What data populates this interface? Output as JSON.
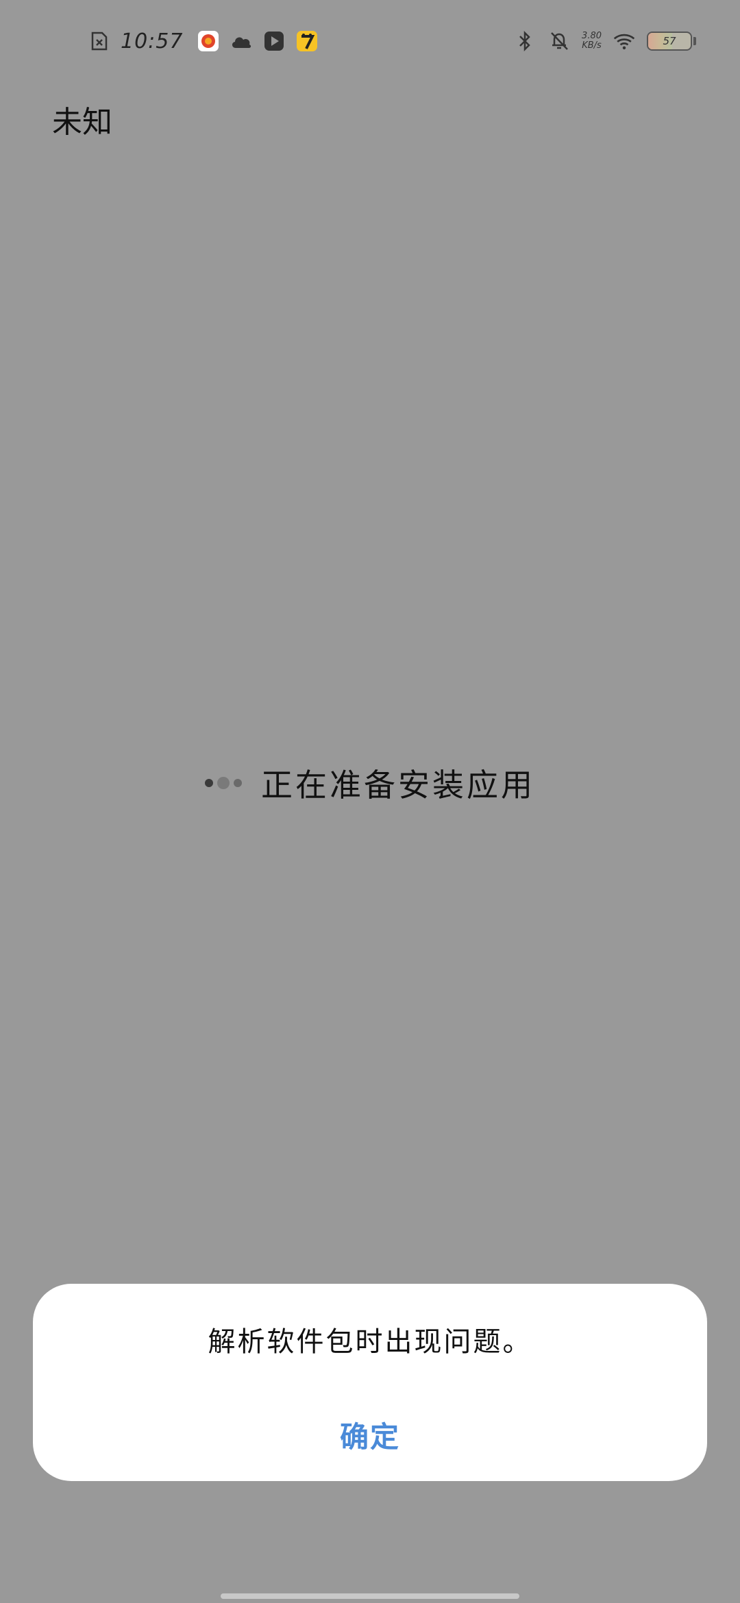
{
  "status_bar": {
    "time": "10:57",
    "left_icons": [
      "sim-error-icon",
      "app-notification-icon",
      "cloud-icon",
      "video-play-icon",
      "seven-cat-app-icon"
    ],
    "right_icons": [
      "bluetooth-icon",
      "mute-bell-icon",
      "wifi-icon",
      "battery-icon"
    ],
    "net_speed_value": "3.80",
    "net_speed_unit": "KB/s",
    "battery_level": "57"
  },
  "page": {
    "title": "未知"
  },
  "loading": {
    "text": "正在准备安装应用"
  },
  "dialog": {
    "message": "解析软件包时出现问题。",
    "confirm_label": "确定",
    "confirm_color": "#4a8ad8"
  },
  "colors": {
    "background": "#999999",
    "dialog_background": "#ffffff"
  }
}
